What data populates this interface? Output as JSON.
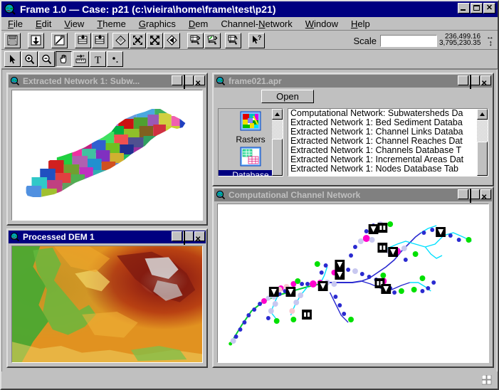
{
  "app": {
    "title": "Frame 1.0  —  Case: p21 (c:\\vieira\\home\\frame\\test\\p21)",
    "icon": "globe-magnifier-icon"
  },
  "window_controls": {
    "minimize": "_",
    "maximize": "□",
    "close": "✕"
  },
  "menubar": {
    "items": [
      {
        "label": "File",
        "mnemonic": "F"
      },
      {
        "label": "Edit",
        "mnemonic": "E"
      },
      {
        "label": "View",
        "mnemonic": "V"
      },
      {
        "label": "Theme",
        "mnemonic": "T"
      },
      {
        "label": "Graphics",
        "mnemonic": "G"
      },
      {
        "label": "Dem",
        "mnemonic": "D"
      },
      {
        "label": "Channel-Network",
        "mnemonic": "N"
      },
      {
        "label": "Window",
        "mnemonic": "W"
      },
      {
        "label": "Help",
        "mnemonic": "H"
      }
    ]
  },
  "toolbar_main": {
    "buttons": [
      {
        "name": "save-project-icon",
        "pressed": false
      },
      {
        "name": "add-theme-icon",
        "pressed": false
      },
      {
        "name": "theme-properties-icon",
        "pressed": false
      },
      {
        "name": "table-import-icon",
        "pressed": false
      },
      {
        "name": "table-export-icon",
        "pressed": false
      },
      {
        "name": "clear-selection-icon",
        "pressed": false
      },
      {
        "name": "zoom-to-selected-icon",
        "pressed": false
      },
      {
        "name": "zoom-to-full-extent-icon",
        "pressed": false
      },
      {
        "name": "zoom-previous-icon",
        "pressed": false
      },
      {
        "name": "grid-to-shape-icon",
        "pressed": false
      },
      {
        "name": "shape-to-grid-icon",
        "pressed": false
      },
      {
        "name": "grid-back-icon",
        "pressed": false
      },
      {
        "name": "help-pointer-icon",
        "pressed": false
      }
    ]
  },
  "toolbar_tools": {
    "buttons": [
      {
        "name": "pointer-tool-icon",
        "pressed": false
      },
      {
        "name": "zoom-in-tool-icon",
        "pressed": false
      },
      {
        "name": "zoom-out-tool-icon",
        "pressed": false
      },
      {
        "name": "pan-hand-tool-icon",
        "pressed": true
      },
      {
        "name": "measure-tool-icon",
        "pressed": false
      },
      {
        "name": "text-tool-icon",
        "pressed": false
      },
      {
        "name": "point-tool-icon",
        "pressed": false
      }
    ]
  },
  "scale": {
    "label": "Scale",
    "value": "",
    "placeholder": "",
    "coord_x": "236,499.16",
    "coord_y": "3,795,230.35",
    "x_axis_symbol": "↔",
    "y_axis_symbol": "↕"
  },
  "windows": {
    "subwatersheds": {
      "title": "Extracted Network 1: Subw...",
      "active": false,
      "icon": "globe-magnifier-icon"
    },
    "dem": {
      "title": "Processed DEM 1",
      "active": true,
      "icon": "globe-magnifier-icon"
    },
    "project": {
      "title": "frame021.apr",
      "active": false,
      "icon": "globe-magnifier-icon",
      "open_button": "Open",
      "doc_types": [
        {
          "label": "Rasters",
          "icon": "raster-layers-icon",
          "selected": false
        },
        {
          "label": "Database",
          "icon": "database-table-icon",
          "selected": true
        }
      ],
      "list_items": [
        "Computational Network: Subwatersheds Da",
        "Extracted Network 1: Bed Sediment Databa",
        "Extracted Network 1: Channel Links Databa",
        "Extracted Network 1: Channel Reaches Dat",
        "Extracted Network 1: Channels Database T",
        "Extracted Network 1: Incremental Areas Dat",
        "Extracted Network 1: Nodes Database Tab"
      ]
    },
    "channel_network": {
      "title": "Computational Channel Network",
      "active": false,
      "icon": "globe-magnifier-icon"
    }
  },
  "statusbar": {
    "resize_grip": "grid-resize-icon"
  },
  "palette": {
    "title_active": "#000080",
    "title_inactive": "#808080",
    "face": "#c0c0c0",
    "node_blue": "#0000d0",
    "node_green": "#00e000",
    "node_magenta": "#ff00cc",
    "node_lavender": "#c8c8f0",
    "node_pink": "#f8c8d0",
    "link_cyan": "#00e0ff",
    "link_green": "#00cc33"
  }
}
